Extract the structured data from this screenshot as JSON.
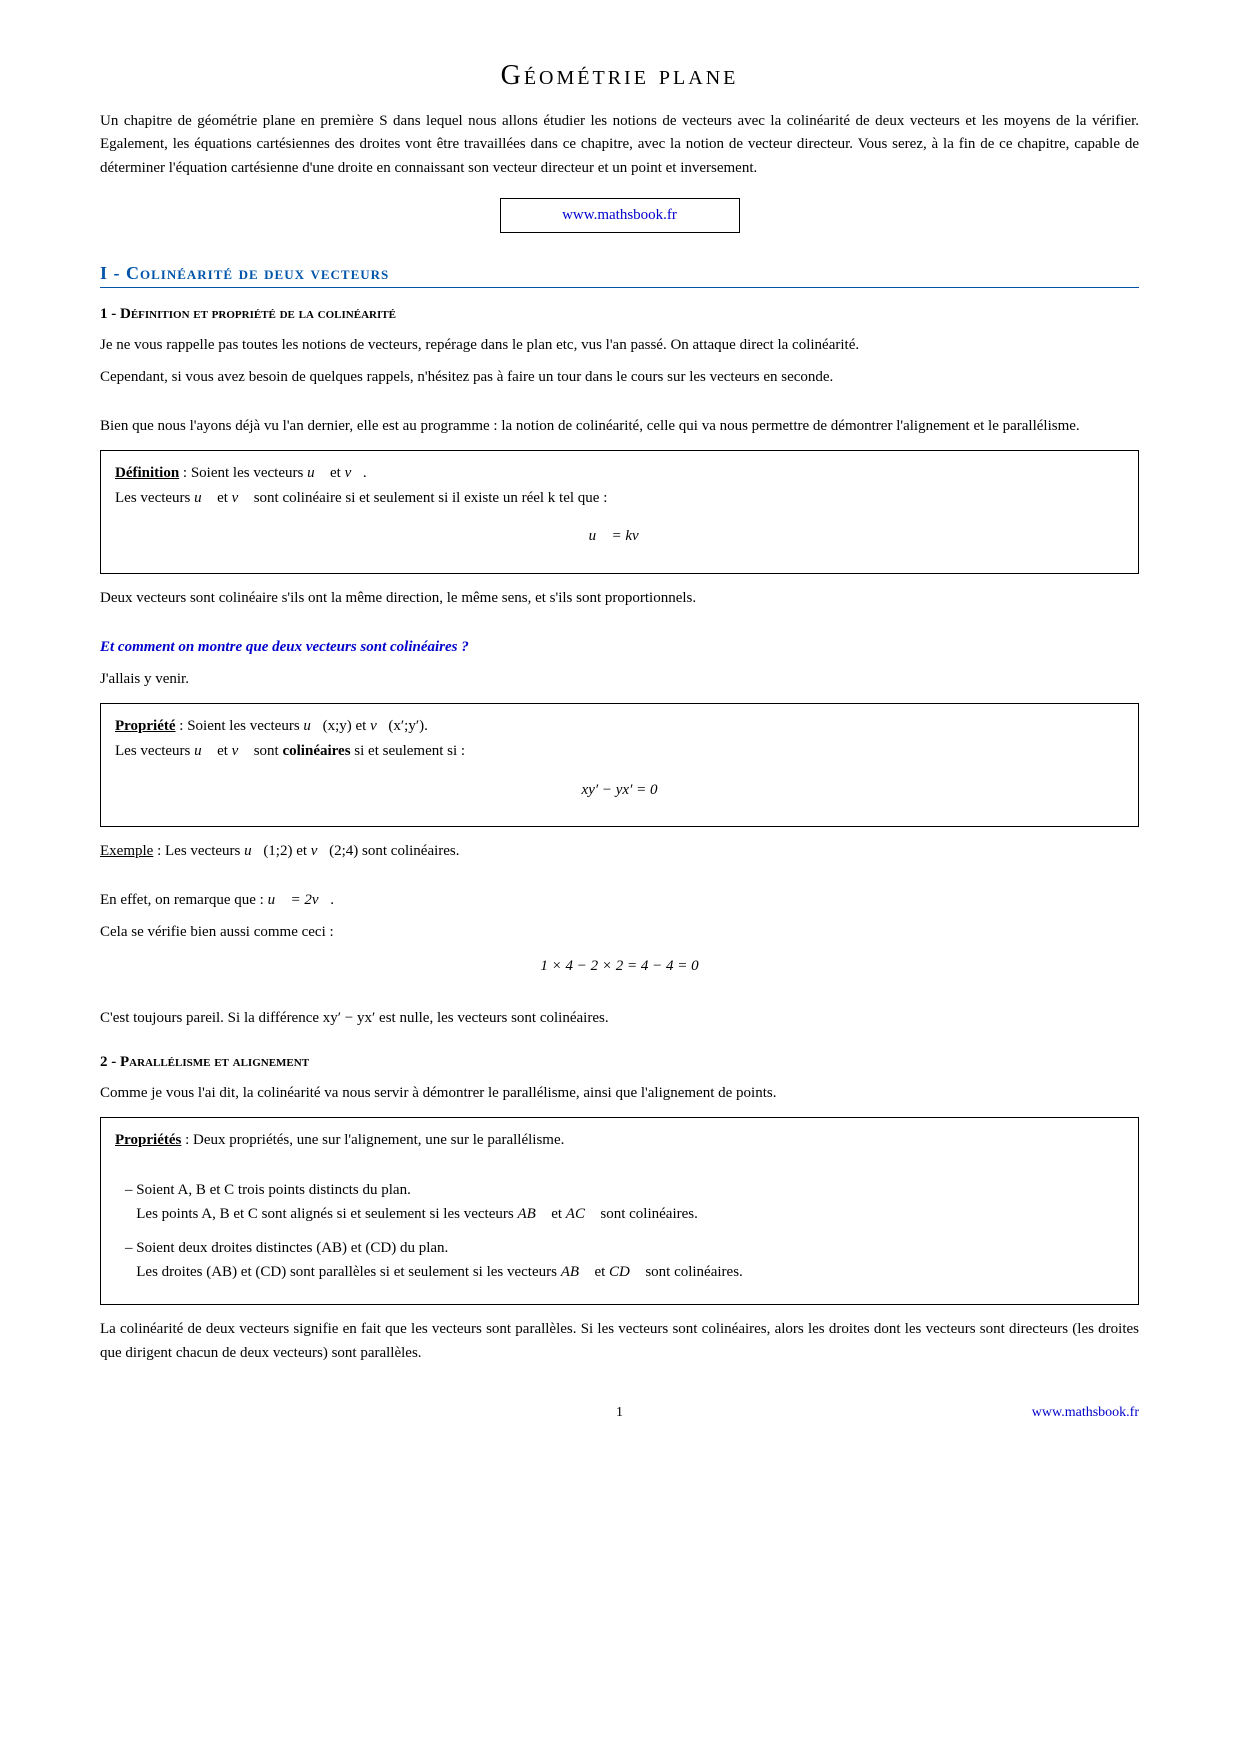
{
  "page": {
    "title": "Géométrie plane",
    "intro": "Un chapitre de géométrie plane en première S dans lequel nous allons étudier les notions de vecteurs avec la colinéarité de deux vecteurs et les moyens de la vérifier. Egalement, les équations cartésiennes des droites vont être travaillées dans ce chapitre, avec la notion de vecteur directeur. Vous serez, à la fin de ce chapitre, capable de déterminer l'équation cartésienne d'une droite en connaissant son vecteur directeur et un point et inversement.",
    "website": "www.mathsbook.fr",
    "section1": {
      "title": "I - Colinéarité de deux vecteurs",
      "sub1": {
        "title": "1 - Définition et propriété de la colinéarité",
        "para1": "Je ne vous rappelle pas toutes les notions de vecteurs, repérage dans le plan etc, vus l'an passé. On attaque direct la colinéarité.",
        "para2": "Cependant, si vous avez besoin de quelques rappels, n'hésitez pas à faire un tour dans le cours sur les vecteurs en seconde.",
        "para3": "Bien que nous l'ayons déjà vu l'an dernier, elle est au programme : la notion de colinéarité, celle qui va nous permettre de démontrer l'alignement et le parallélisme.",
        "def_label": "Définition",
        "def_text1": " : Soient les vecteurs ",
        "def_text2": " et ",
        "def_text3": ". Les vecteurs ",
        "def_text4": " et ",
        "def_text5": " sont colinéaire si et seulement si il existe un réel k tel que :",
        "def_formula": "u⃗ = kv⃗",
        "para4": "Deux vecteurs sont colinéaire s'ils ont la même direction, le même sens, et s'ils sont proportionnels.",
        "italic_question": "Et comment on montre que deux vecteurs sont colinéaires ?",
        "italic_answer": "J'allais y venir.",
        "prop_label": "Propriété",
        "prop_text1": " : Soient les vecteurs ",
        "prop_text2": " et ",
        "prop_text3": ". Les vecteurs ",
        "prop_text4": " et ",
        "prop_text5": " sont ",
        "prop_bold": "colinéaires",
        "prop_text6": " si et seulement si :",
        "prop_formula": "xy′ − yx′ = 0",
        "ex_label": "Exemple",
        "ex_text": " : Les vecteurs ",
        "ex_u": "u⃗(1;2)",
        "ex_and": " et ",
        "ex_v": "v⃗(2;4)",
        "ex_end": " sont colinéaires.",
        "ex_para1a": "En effet, on remarque que : ",
        "ex_para1b": "u⃗ = 2v⃗",
        "ex_para1c": ".",
        "ex_para2": "Cela se vérifie bien aussi comme ceci :",
        "ex_formula": "1 × 4 − 2 × 2 = 4 − 4 = 0",
        "conclusion": "C'est toujours pareil. Si la différence xy′ − yx′ est nulle, les vecteurs sont colinéaires."
      },
      "sub2": {
        "title": "2 - Parallélisme et alignement",
        "para1": "Comme je vous l'ai dit, la colinéarité va nous servir à démontrer le parallélisme, ainsi que l'alignement de points.",
        "props_label": "Propriétés",
        "props_text": " : Deux propriétés, une sur l'alignement, une sur le parallélisme.",
        "prop1_title": "– Soient A, B et C trois points distincts du plan.",
        "prop1_body": "Les points A, B et C sont alignés si et seulement si les vecteurs AB⃗ et AC⃗ sont colinéaires.",
        "prop2_title": "– Soient deux droites distinctes (AB) et (CD) du plan.",
        "prop2_body": "Les droites (AB) et (CD) sont parallèles si et seulement si les vecteurs AB⃗ et CD⃗ sont colinéaires.",
        "final_para": "La colinéarité de deux vecteurs signifie en fait que les vecteurs sont parallèles. Si les vecteurs sont colinéaires, alors les droites dont les vecteurs sont directeurs (les droites que dirigent chacun de deux vecteurs) sont parallèles."
      }
    },
    "footer": {
      "page_number": "1",
      "website": "www.mathsbook.fr"
    }
  }
}
